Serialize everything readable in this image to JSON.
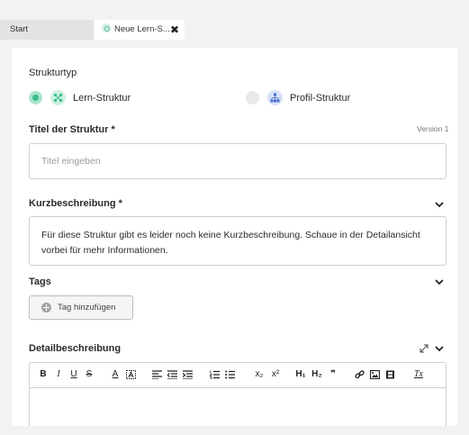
{
  "tabs": {
    "start_label": "Start",
    "active_label": "Neue Lern-S...",
    "close_symbol": "✖"
  },
  "form": {
    "structure_type_label": "Strukturtyp",
    "option_learn_label": "Lern-Struktur",
    "option_profile_label": "Profil-Struktur",
    "selected_option": "Lern-Struktur",
    "title_label": "Titel der Struktur *",
    "version_label": "Version 1",
    "title_placeholder": "Titel eingeben",
    "title_value": "",
    "short_description_label": "Kurzbeschreibung *",
    "short_description_text": "Für diese Struktur gibt es leider noch keine Kurzbeschreibung. Schaue in der Detailansicht vorbei für mehr Informationen.",
    "tags_label": "Tags",
    "add_tag_label": "Tag hinzufügen",
    "detail_description_label": "Detailbeschreibung"
  },
  "editor_toolbar": {
    "bold": "B",
    "italic": "I",
    "underline": "U",
    "strikethrough": "S",
    "font_color": "A",
    "heading1": "H₁",
    "heading2": "H₂",
    "quote": "❞",
    "subscript": "x₂",
    "superscript": "x²",
    "clear_format": "Tx"
  },
  "colors": {
    "accent_green": "#3dbd8c",
    "accent_green_light": "#a8e4cc",
    "accent_blue_light": "#d8e1f7",
    "icon_blue": "#4a6fc9"
  },
  "icons": {
    "learn_structure": "structure-nodes-icon",
    "profile_structure": "hierarchy-icon",
    "collapse": "chevron-down-icon",
    "expand": "expand-arrows-icon",
    "add": "plus-circle-icon"
  }
}
